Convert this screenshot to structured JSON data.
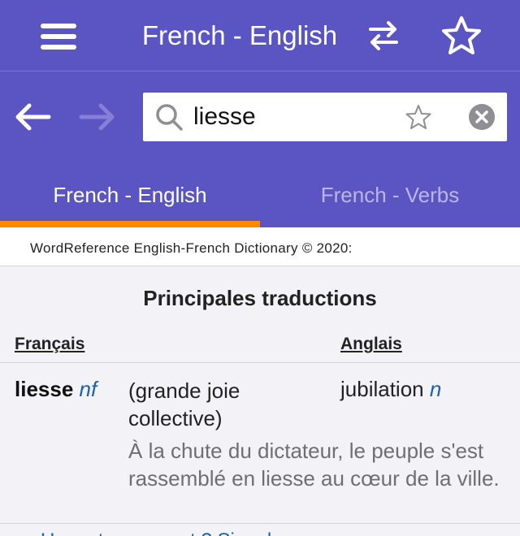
{
  "header": {
    "title": "French - English",
    "icons": {
      "menu": "hamburger-menu-icon",
      "swap": "swap-languages-icon",
      "favorite": "star-outline-icon"
    }
  },
  "search": {
    "value": "liesse",
    "placeholder": "",
    "icons": {
      "back": "arrow-left-icon",
      "forward": "arrow-right-icon",
      "search": "magnifier-icon",
      "favorite": "star-outline-icon",
      "clear": "clear-x-icon"
    }
  },
  "tabs": [
    {
      "label": "French - English",
      "active": true
    },
    {
      "label": "French - Verbs",
      "active": false
    }
  ],
  "content": {
    "copyright": "WordReference English-French Dictionary © 2020:",
    "section_title": "Principales traductions",
    "col_fr": "Français",
    "col_en": "Anglais",
    "entry": {
      "word": "liesse",
      "pos": "nf",
      "sense": "(grande joie collective)",
      "translation": "jubilation",
      "translation_pos": "n",
      "example": "À la chute du dictateur, le peuple s'est rassemblé en liesse au cœur de la ville."
    },
    "bottom_link": "Un mot manquant ? Signalez une erreur ..."
  },
  "colors": {
    "header_bg": "#5b55c3",
    "tab_indicator": "#ff8a00",
    "pos_blue": "#1b5fb0"
  }
}
